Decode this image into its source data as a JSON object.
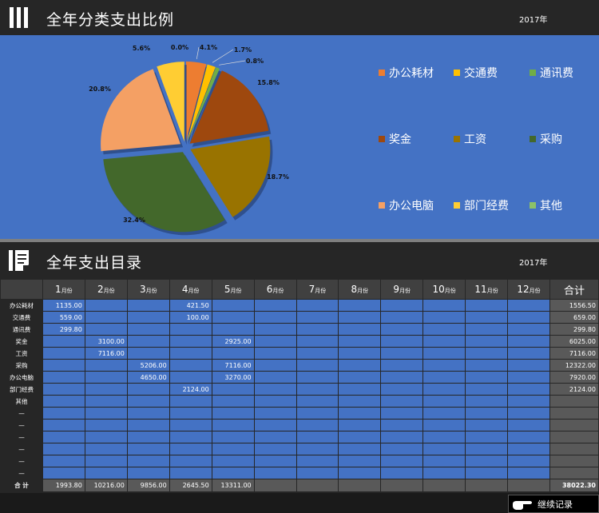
{
  "header1": {
    "title": "全年分类支出比例",
    "year": "2017年"
  },
  "header2": {
    "title": "全年支出目录",
    "year": "2017年"
  },
  "colors": {
    "accent_blue": "#4472c4",
    "dark": "#262626",
    "gray": "#595959"
  },
  "chart_data": {
    "type": "pie",
    "categories": [
      "办公耗材",
      "交通费",
      "通讯费",
      "奖金",
      "工资",
      "采购",
      "办公电脑",
      "部门经费",
      "其他"
    ],
    "values": [
      4.1,
      1.7,
      0.8,
      15.8,
      18.7,
      32.4,
      20.8,
      5.6,
      0.0
    ],
    "labels": [
      "4.1%",
      "1.7%",
      "0.8%",
      "15.8%",
      "18.7%",
      "32.4%",
      "20.8%",
      "5.6%",
      "0.0%"
    ],
    "colors": [
      "#ed7d31",
      "#ffc000",
      "#70ad47",
      "#9e480e",
      "#997300",
      "#43682b",
      "#f4a064",
      "#ffcd33",
      "#8cc168"
    ],
    "exploded": true,
    "legend": "right"
  },
  "table": {
    "months": [
      "1",
      "2",
      "3",
      "4",
      "5",
      "6",
      "7",
      "8",
      "9",
      "10",
      "11",
      "12"
    ],
    "month_unit": "月份",
    "total_header": "合计",
    "rows": [
      {
        "label": "办公耗材",
        "cells": [
          "1135.00",
          "",
          "",
          "421.50",
          "",
          "",
          "",
          "",
          "",
          "",
          "",
          ""
        ],
        "total": "1556.50"
      },
      {
        "label": "交通费",
        "cells": [
          "559.00",
          "",
          "",
          "100.00",
          "",
          "",
          "",
          "",
          "",
          "",
          "",
          ""
        ],
        "total": "659.00"
      },
      {
        "label": "通讯费",
        "cells": [
          "299.80",
          "",
          "",
          "",
          "",
          "",
          "",
          "",
          "",
          "",
          "",
          ""
        ],
        "total": "299.80"
      },
      {
        "label": "奖金",
        "cells": [
          "",
          "3100.00",
          "",
          "",
          "2925.00",
          "",
          "",
          "",
          "",
          "",
          "",
          ""
        ],
        "total": "6025.00"
      },
      {
        "label": "工资",
        "cells": [
          "",
          "7116.00",
          "",
          "",
          "",
          "",
          "",
          "",
          "",
          "",
          "",
          ""
        ],
        "total": "7116.00"
      },
      {
        "label": "采购",
        "cells": [
          "",
          "",
          "5206.00",
          "",
          "7116.00",
          "",
          "",
          "",
          "",
          "",
          "",
          ""
        ],
        "total": "12322.00"
      },
      {
        "label": "办公电脑",
        "cells": [
          "",
          "",
          "4650.00",
          "",
          "3270.00",
          "",
          "",
          "",
          "",
          "",
          "",
          ""
        ],
        "total": "7920.00"
      },
      {
        "label": "部门经费",
        "cells": [
          "",
          "",
          "",
          "2124.00",
          "",
          "",
          "",
          "",
          "",
          "",
          "",
          ""
        ],
        "total": "2124.00"
      },
      {
        "label": "其他",
        "cells": [
          "",
          "",
          "",
          "",
          "",
          "",
          "",
          "",
          "",
          "",
          "",
          ""
        ],
        "total": ""
      },
      {
        "label": "—",
        "cells": [
          "",
          "",
          "",
          "",
          "",
          "",
          "",
          "",
          "",
          "",
          "",
          ""
        ],
        "total": ""
      },
      {
        "label": "—",
        "cells": [
          "",
          "",
          "",
          "",
          "",
          "",
          "",
          "",
          "",
          "",
          "",
          ""
        ],
        "total": ""
      },
      {
        "label": "—",
        "cells": [
          "",
          "",
          "",
          "",
          "",
          "",
          "",
          "",
          "",
          "",
          "",
          ""
        ],
        "total": ""
      },
      {
        "label": "—",
        "cells": [
          "",
          "",
          "",
          "",
          "",
          "",
          "",
          "",
          "",
          "",
          "",
          ""
        ],
        "total": ""
      },
      {
        "label": "—",
        "cells": [
          "",
          "",
          "",
          "",
          "",
          "",
          "",
          "",
          "",
          "",
          "",
          ""
        ],
        "total": ""
      },
      {
        "label": "—",
        "cells": [
          "",
          "",
          "",
          "",
          "",
          "",
          "",
          "",
          "",
          "",
          "",
          ""
        ],
        "total": ""
      }
    ],
    "sum_label": "合  计",
    "sums": [
      "1993.80",
      "10216.00",
      "9856.00",
      "2645.50",
      "13311.00",
      "",
      "",
      "",
      "",
      "",
      "",
      ""
    ],
    "grand_total": "38022.30"
  },
  "footer": {
    "continue_label": "继续记录",
    "hand_icon": "pointing-hand-icon"
  }
}
